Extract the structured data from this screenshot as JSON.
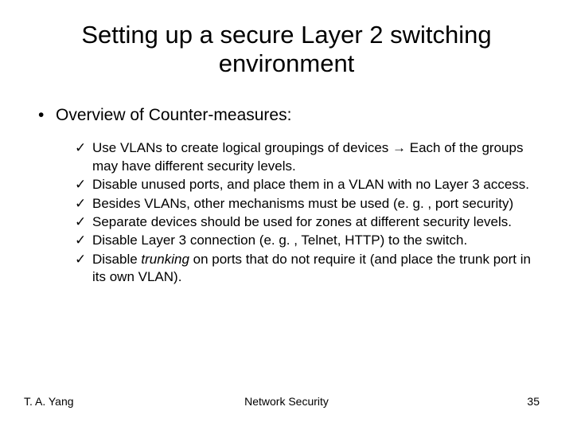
{
  "title": "Setting up a secure Layer 2 switching environment",
  "heading": "Overview of Counter-measures:",
  "arrow": "→",
  "items": [
    {
      "pre": "Use VLANs to create logical groupings of devices ",
      "post": " Each of the groups may have different security levels.",
      "hasArrow": true
    },
    {
      "text": "Disable unused ports, and place them in a VLAN with no Layer 3 access."
    },
    {
      "text": "Besides VLANs, other mechanisms must be used (e. g. , port security)"
    },
    {
      "text": "Separate devices should be used for zones at different security levels."
    },
    {
      "text": "Disable Layer 3 connection (e. g. , Telnet, HTTP) to the switch."
    },
    {
      "pre": "Disable ",
      "em": "trunking",
      "post": " on ports that do not require it (and place the trunk port in its own VLAN)."
    }
  ],
  "footer": {
    "left": "T. A. Yang",
    "center": "Network Security",
    "right": "35"
  },
  "marks": {
    "bullet": "•",
    "check": "✓"
  }
}
